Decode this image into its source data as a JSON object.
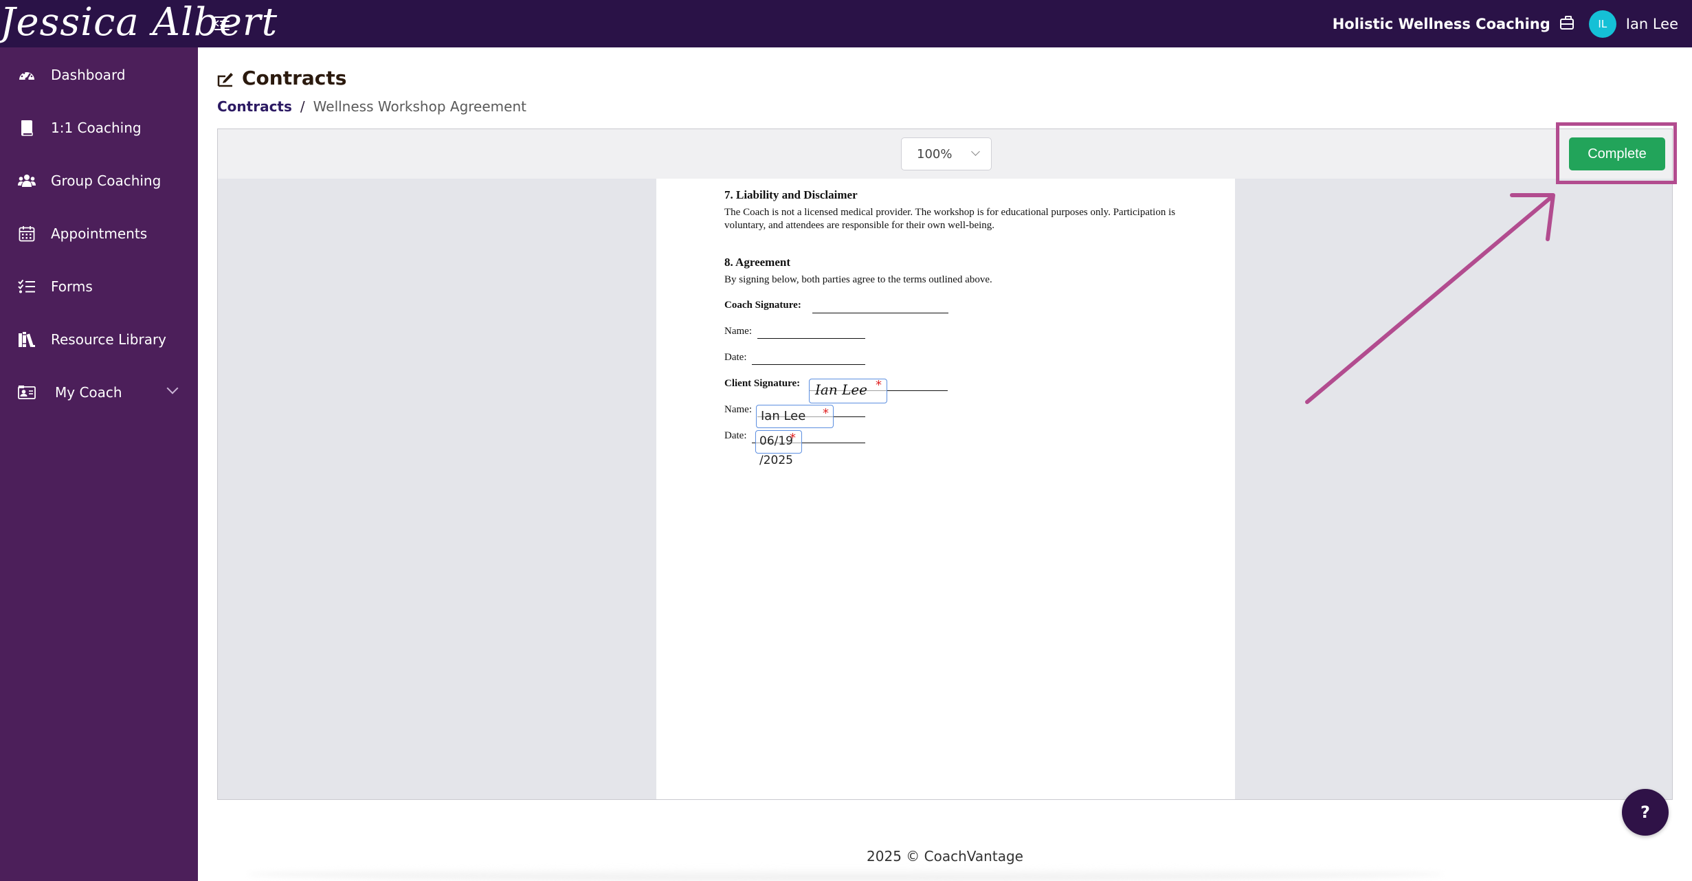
{
  "topbar": {
    "logo_text": "Jessica Albert",
    "business_name": "Holistic Wellness Coaching",
    "avatar_initials": "IL",
    "user_name": "Ian Lee"
  },
  "sidebar": {
    "items": [
      {
        "label": "Dashboard",
        "icon": "dashboard-gauge-icon"
      },
      {
        "label": "1:1 Coaching",
        "icon": "book-icon"
      },
      {
        "label": "Group Coaching",
        "icon": "users-icon"
      },
      {
        "label": "Appointments",
        "icon": "calendar-icon"
      },
      {
        "label": "Forms",
        "icon": "checklist-icon"
      },
      {
        "label": "Resource Library",
        "icon": "books-icon"
      },
      {
        "label": "My Coach",
        "icon": "id-card-icon",
        "has_dropdown": true
      }
    ]
  },
  "header": {
    "title": "Contracts",
    "breadcrumb": {
      "link": "Contracts",
      "separator": "/",
      "current": "Wellness Workshop Agreement"
    }
  },
  "viewer": {
    "zoom": "100%",
    "complete_label": "Complete"
  },
  "document": {
    "section7_heading": "7. Liability and Disclaimer",
    "section7_text": "The Coach is not a licensed medical provider. The workshop is for educational purposes only. Participation is voluntary, and attendees are responsible for their own well-being.",
    "section8_heading": "8. Agreement",
    "section8_text": "By signing below, both parties agree to the terms outlined above.",
    "coach_signature_label": "Coach Signature:",
    "coach_name_label": "Name:",
    "coach_date_label": "Date:",
    "client_signature_label": "Client Signature:",
    "client_signature_value": "Ian Lee",
    "client_name_label": "Name:",
    "client_name_value": "Ian Lee",
    "client_date_label": "Date:",
    "client_date_value_line1": "06/19",
    "client_date_value_line2": "/2025",
    "required_mark": "*"
  },
  "footer": {
    "text": "2025 © CoachVantage"
  },
  "help": {
    "label": "?"
  },
  "colors": {
    "topbar": "#2a1247",
    "sidebar": "#4c1f5a",
    "complete_button": "#22a45a",
    "annotation": "#b24c8f",
    "avatar": "#15c0d6",
    "field_border": "#5b8ee0",
    "required": "#e02424"
  }
}
